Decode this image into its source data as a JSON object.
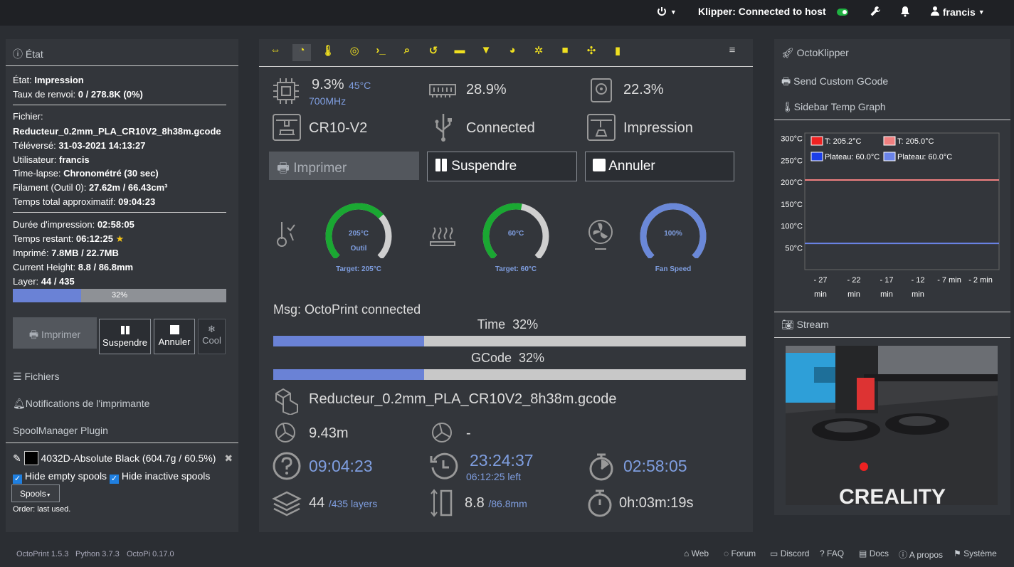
{
  "topbar": {
    "status": "Klipper: Connected to host",
    "user": "francis"
  },
  "left": {
    "state_title": "État",
    "lines": {
      "state_label": "État:",
      "state_val": "Impression",
      "resend_label": "Taux de renvoi:",
      "resend_val": "0 / 278.8K (0%)",
      "file_label": "Fichier:",
      "file_val": "Reducteur_0.2mm_PLA_CR10V2_8h38m.gcode",
      "uploaded_label": "Téléversé:",
      "uploaded_val": "31-03-2021 14:13:27",
      "user_label": "Utilisateur:",
      "user_val": "francis",
      "timelapse_label": "Time-lapse:",
      "timelapse_val": "Chronométré (30 sec)",
      "filament_label": "Filament (Outil 0):",
      "filament_val": "27.62m / 66.43cm³",
      "total_label": "Temps total approximatif:",
      "total_val": "09:04:23",
      "printtime_label": "Durée d'impression:",
      "printtime_val": "02:58:05",
      "left_label": "Temps restant:",
      "left_val": "06:12:25",
      "printed_label": "Imprimé:",
      "printed_val": "7.8MB / 22.7MB",
      "height_label": "Current Height:",
      "height_val": "8.8 / 86.8mm",
      "layer_label": "Layer:",
      "layer_val": "44 / 435"
    },
    "progress_text": "32%",
    "progress_fraction": 0.32,
    "buttons": {
      "print": "Imprimer",
      "pause": "Suspendre",
      "cancel": "Annuler",
      "cool": "Cool"
    },
    "files": "Fichiers",
    "notifications": "Notifications de l'imprimante",
    "spool_title": "SpoolManager Plugin",
    "spool_name": "4032D-Absolute Black (604.7g / 60.5%)",
    "hide_empty": "Hide empty spools",
    "hide_inactive": "Hide inactive spools",
    "spools_btn": "Spools",
    "order": "Order: last used."
  },
  "mid": {
    "cpu": "9.3%",
    "cpu_temp": "45°C",
    "cpu_freq": "700MHz",
    "mem": "28.9%",
    "disk": "22.3%",
    "printer": "CR10-V2",
    "conn": "Connected",
    "state": "Impression",
    "btn_print": "Imprimer",
    "btn_pause": "Suspendre",
    "btn_cancel": "Annuler",
    "tool_temp": "205°C",
    "tool_name": "Outil",
    "tool_target": "Target: 205°C",
    "bed_temp": "60°C",
    "bed_target": "Target: 60°C",
    "fan": "100%",
    "fan_label": "Fan Speed",
    "tool_fraction": 0.68,
    "bed_fraction": 0.54,
    "fan_fraction": 1.0,
    "msg": "Msg: OctoPrint connected",
    "time_label": "Time",
    "time_pct": "32%",
    "gcode_label": "GCode",
    "gcode_pct": "32%",
    "time_fraction": 0.32,
    "gcode_fraction": 0.32,
    "file": "Reducteur_0.2mm_PLA_CR10V2_8h38m.gcode",
    "filament": "9.43m",
    "filament2": "-",
    "est": "09:04:23",
    "eta": "23:24:37",
    "eta_left": "06:12:25 left",
    "elapsed": "02:58:05",
    "layer": "44",
    "layer_total": "/435 layers",
    "height": "8.8",
    "height_total": "/86.8mm",
    "timer": "0h:03m:19s"
  },
  "right": {
    "octoklipper": "OctoKlipper",
    "custom_gcode": "Send Custom GCode",
    "temp_graph": "Sidebar Temp Graph",
    "stream": "Stream",
    "legend": [
      "T: 205.2°C",
      "T: 205.0°C",
      "Plateau: 60.0°C",
      "Plateau: 60.0°C"
    ],
    "y_ticks": [
      "300°C",
      "250°C",
      "200°C",
      "150°C",
      "100°C",
      "50°C"
    ],
    "x_ticks": [
      [
        "- 27",
        "min"
      ],
      [
        "- 22",
        "min"
      ],
      [
        "- 17",
        "min"
      ],
      [
        "- 12",
        "min"
      ],
      [
        "- 7 min",
        ""
      ],
      [
        "- 2 min",
        ""
      ]
    ],
    "stream_logo": "CREALITY"
  },
  "footer": {
    "octoprint": "OctoPrint 1.5.3",
    "python": "Python 3.7.3",
    "octopi": "OctoPi 0.17.0",
    "links": [
      "Web",
      "Forum",
      "Discord",
      "FAQ",
      "Docs",
      "A propos",
      "Système"
    ]
  }
}
